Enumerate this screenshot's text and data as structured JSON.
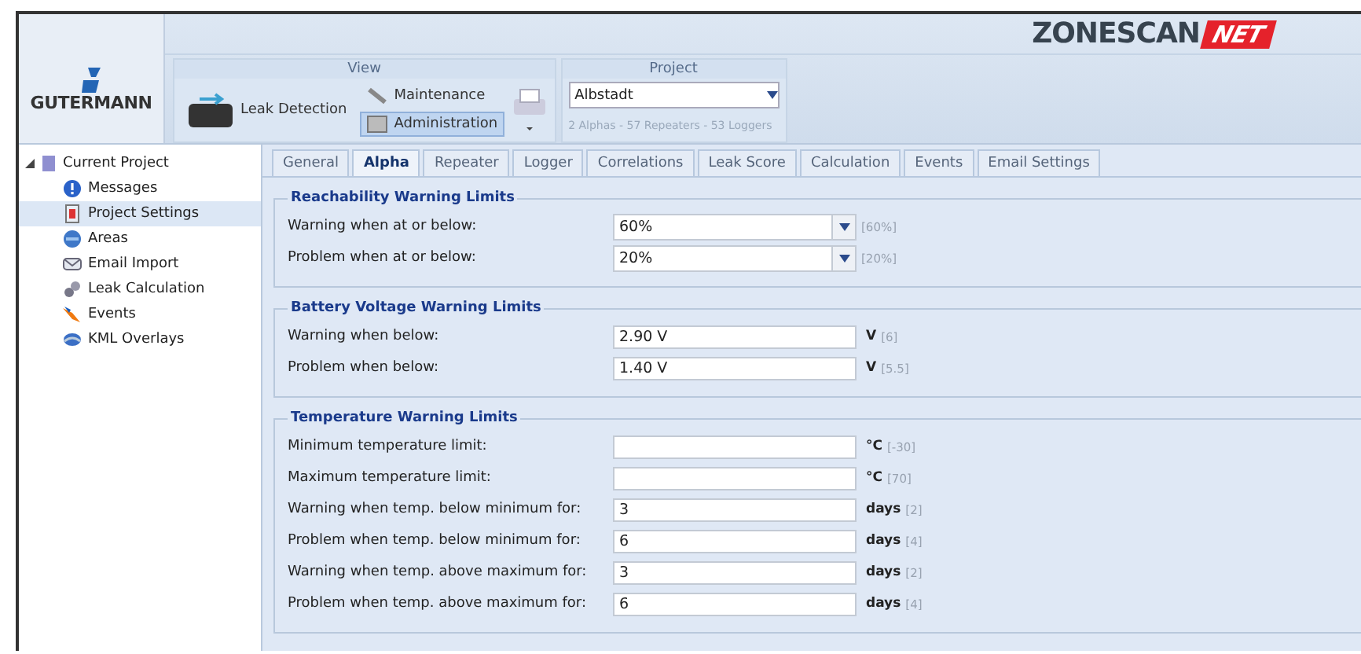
{
  "brand": {
    "name": "GUTERMANN"
  },
  "product_logo": {
    "name": "ZONESCAN",
    "suffix": "NET"
  },
  "ribbon": {
    "view": {
      "title": "View",
      "items": [
        {
          "label": "Leak Detection",
          "kind": "large",
          "selected": false
        },
        {
          "label": "Maintenance",
          "kind": "small",
          "selected": false
        },
        {
          "label": "Administration",
          "kind": "small",
          "selected": true
        }
      ]
    },
    "project": {
      "title": "Project",
      "value": "Albstadt",
      "summary": "2 Alphas - 57 Repeaters - 53 Loggers"
    }
  },
  "sidebar": {
    "root": {
      "label": "Current Project",
      "expanded": true,
      "children": [
        {
          "label": "Messages",
          "selected": false
        },
        {
          "label": "Project Settings",
          "selected": true
        },
        {
          "label": "Areas",
          "selected": false
        },
        {
          "label": "Email Import",
          "selected": false
        },
        {
          "label": "Leak Calculation",
          "selected": false
        },
        {
          "label": "Events",
          "selected": false
        },
        {
          "label": "KML Overlays",
          "selected": false
        }
      ]
    }
  },
  "tabs": [
    {
      "label": "General",
      "selected": false
    },
    {
      "label": "Alpha",
      "selected": true
    },
    {
      "label": "Repeater",
      "selected": false
    },
    {
      "label": "Logger",
      "selected": false
    },
    {
      "label": "Correlations",
      "selected": false
    },
    {
      "label": "Leak Score",
      "selected": false
    },
    {
      "label": "Calculation",
      "selected": false
    },
    {
      "label": "Events",
      "selected": false
    },
    {
      "label": "Email Settings",
      "selected": false
    }
  ],
  "sections": [
    {
      "title": "Reachability Warning Limits",
      "fields": [
        {
          "label": "Warning when at or below:",
          "kind": "dropdown",
          "value": "60%",
          "default": "[60%]"
        },
        {
          "label": "Problem when at or below:",
          "kind": "dropdown",
          "value": "20%",
          "default": "[20%]"
        }
      ]
    },
    {
      "title": "Battery Voltage Warning Limits",
      "fields": [
        {
          "label": "Warning when below:",
          "kind": "text",
          "value": "2.90 V",
          "unit": "V",
          "default": "[6]"
        },
        {
          "label": "Problem when below:",
          "kind": "text",
          "value": "1.40 V",
          "unit": "V",
          "default": "[5.5]"
        }
      ]
    },
    {
      "title": "Temperature Warning Limits",
      "fields": [
        {
          "label": "Minimum temperature limit:",
          "kind": "text",
          "unit": "°C",
          "default": "[-30]"
        },
        {
          "label": "Maximum temperature limit:",
          "kind": "text",
          "unit": "°C",
          "default": "[70]"
        },
        {
          "label": "Warning when temp. below minimum for:",
          "kind": "text",
          "value": "3",
          "unit": "days",
          "default": "[2]"
        },
        {
          "label": "Problem when temp. below minimum for:",
          "kind": "text",
          "value": "6",
          "unit": "days",
          "default": "[4]"
        },
        {
          "label": "Warning when temp. above maximum for:",
          "kind": "text",
          "value": "3",
          "unit": "days",
          "default": "[2]"
        },
        {
          "label": "Problem when temp. above maximum for:",
          "kind": "text",
          "value": "6",
          "unit": "days",
          "default": "[4]"
        }
      ]
    }
  ]
}
